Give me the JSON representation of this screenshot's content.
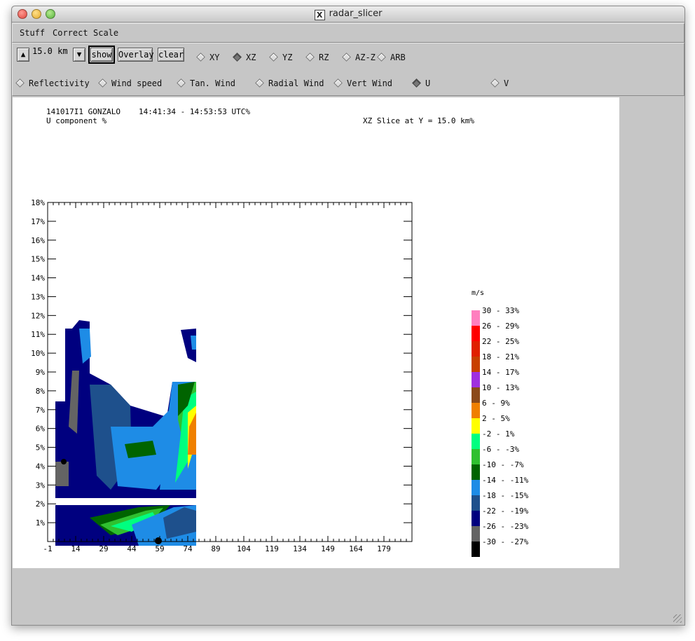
{
  "window": {
    "title": "radar_slicer"
  },
  "menu": [
    "Stuff",
    "Correct",
    "Scale"
  ],
  "controls": {
    "km_value": "15.0 km",
    "up_arrow": "▲",
    "down_arrow": "▼",
    "show_label": "show",
    "overlay_label": "Overlay",
    "clear_label": "clear",
    "slice_modes": [
      {
        "label": "XY",
        "selected": false
      },
      {
        "label": "XZ",
        "selected": true
      },
      {
        "label": "YZ",
        "selected": false
      },
      {
        "label": "RZ",
        "selected": false
      },
      {
        "label": "AZ-Z",
        "selected": false
      },
      {
        "label": "ARB",
        "selected": false
      }
    ],
    "fields": [
      {
        "label": "Reflectivity",
        "selected": false
      },
      {
        "label": "Wind speed",
        "selected": false
      },
      {
        "label": "Tan. Wind",
        "selected": false
      },
      {
        "label": "Radial Wind",
        "selected": false
      },
      {
        "label": "Vert Wind",
        "selected": false
      },
      {
        "label": "U",
        "selected": true
      },
      {
        "label": "V",
        "selected": false
      }
    ]
  },
  "plot": {
    "storm_id": "141017I1 GONZALO",
    "time_range": "14:41:34 - 14:53:53 UTC%",
    "component": "U component %",
    "slice_label": "XZ Slice at Y = 15.0 km%",
    "units": "m/s"
  },
  "chart_data": {
    "type": "heatmap",
    "title": "",
    "x_ticks": [
      "-1",
      "14",
      "29",
      "44",
      "59",
      "74",
      "89",
      "104",
      "119",
      "134",
      "149",
      "164",
      "179"
    ],
    "y_ticks": [
      "1%",
      "2%",
      "3%",
      "4%",
      "5%",
      "6%",
      "7%",
      "8%",
      "9%",
      "10%",
      "11%",
      "12%",
      "13%",
      "14%",
      "15%",
      "16%",
      "17%",
      "18%"
    ],
    "xlim": [
      -1,
      194
    ],
    "ylim": [
      0,
      18
    ],
    "legend": [
      {
        "label": "30 - 33%",
        "color": "#ff7fbf"
      },
      {
        "label": "26 - 29%",
        "color": "#ff0000"
      },
      {
        "label": "22 - 25%",
        "color": "#e02000"
      },
      {
        "label": "18 - 21%",
        "color": "#c84000"
      },
      {
        "label": "14 - 17%",
        "color": "#a030e0"
      },
      {
        "label": "10 - 13%",
        "color": "#8b4a1a"
      },
      {
        "label": "6 - 9%",
        "color": "#f08000"
      },
      {
        "label": "2 - 5%",
        "color": "#ffff00"
      },
      {
        "label": "-2 - 1%",
        "color": "#00ff80"
      },
      {
        "label": "-6 - -3%",
        "color": "#30c030"
      },
      {
        "label": "-10 - -7%",
        "color": "#006400"
      },
      {
        "label": "-14 - -11%",
        "color": "#1e8ce6"
      },
      {
        "label": "-18 - -15%",
        "color": "#1e508c"
      },
      {
        "label": "-22 - -19%",
        "color": "#00007f"
      },
      {
        "label": "-26 - -23%",
        "color": "#646464"
      },
      {
        "label": "-30 - -27%",
        "color": "#000000"
      }
    ]
  }
}
